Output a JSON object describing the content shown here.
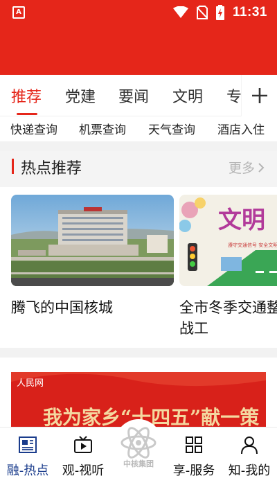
{
  "status_bar": {
    "time": "11:31",
    "left_badge": "A"
  },
  "tabs": [
    {
      "label": "推荐",
      "active": true
    },
    {
      "label": "党建"
    },
    {
      "label": "要闻"
    },
    {
      "label": "文明"
    },
    {
      "label": "专"
    }
  ],
  "quick_links": [
    "快递查询",
    "机票查询",
    "天气查询",
    "酒店入住"
  ],
  "section": {
    "title": "热点推荐",
    "more": "更多"
  },
  "cards": [
    {
      "title": "腾飞的中国核城"
    },
    {
      "title": "全市冬季交通整治百日会战工"
    }
  ],
  "banner": {
    "text": "我为家乡“十四五”献一策",
    "logo": "人民网"
  },
  "bottom_nav": [
    {
      "label": "融-热点",
      "icon": "newspaper-icon",
      "active": true
    },
    {
      "label": "观-视听",
      "icon": "video-icon"
    },
    {
      "label": "中核集团",
      "icon": "atom-logo-icon"
    },
    {
      "label": "享-服务",
      "icon": "grid-icon"
    },
    {
      "label": "知-我的",
      "icon": "person-icon"
    }
  ],
  "colors": {
    "brand_red": "#e5261a",
    "active_nav": "#1a3c8c"
  }
}
